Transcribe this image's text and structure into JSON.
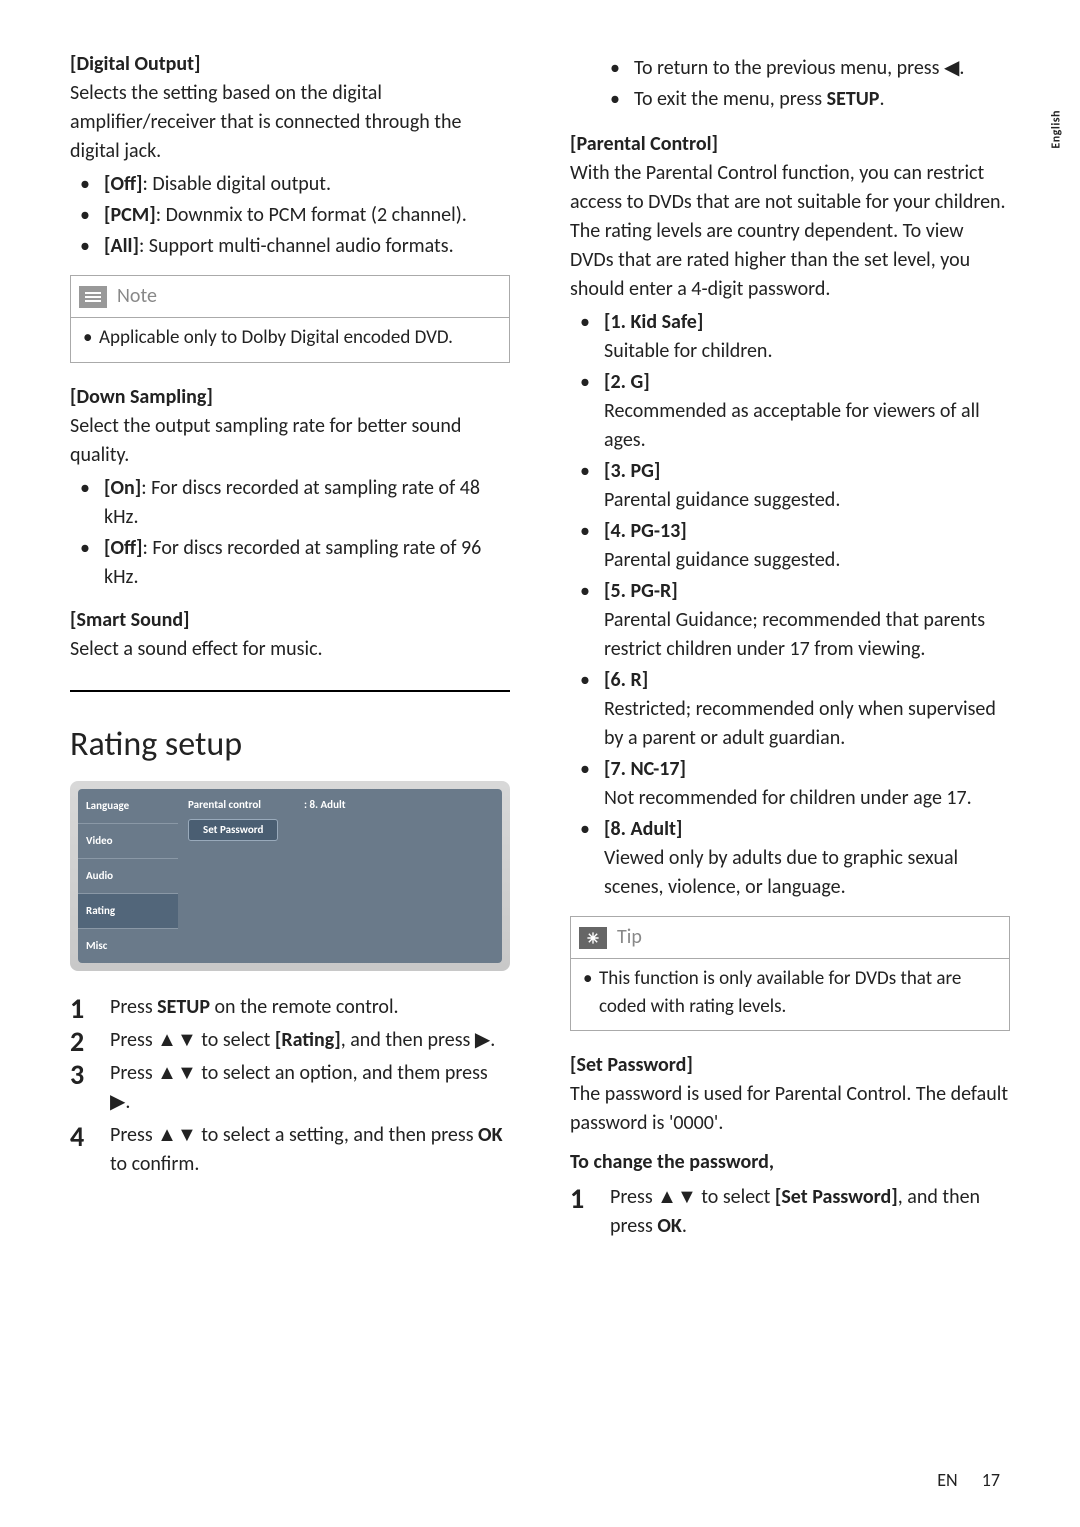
{
  "side_lang": "English",
  "left": {
    "digital_output": {
      "title": "[Digital Output]",
      "intro": "Selects the setting based on the digital amplifier/receiver that is connected through the digital jack.",
      "items": [
        {
          "label": "[Off]",
          "desc": ": Disable digital output."
        },
        {
          "label": "[PCM]",
          "desc": ": Downmix to PCM format (2 channel)."
        },
        {
          "label": "[All]",
          "desc": ": Support multi-channel audio formats."
        }
      ]
    },
    "note": {
      "heading": "Note",
      "text": "Applicable only to Dolby Digital encoded DVD."
    },
    "down_sampling": {
      "title": "[Down Sampling]",
      "intro": "Select the output sampling rate for better sound quality.",
      "items": [
        {
          "label": "[On]",
          "desc": ": For discs recorded at sampling rate of 48 kHz."
        },
        {
          "label": "[Off]",
          "desc": ": For discs recorded at sampling rate of 96 kHz."
        }
      ]
    },
    "smart_sound": {
      "title": "[Smart Sound]",
      "intro": "Select a sound effect for music."
    },
    "rating_heading": "Rating setup",
    "menu": {
      "tabs": [
        "Language",
        "Video",
        "Audio",
        "Rating",
        "Misc"
      ],
      "selected_index": 3,
      "row_label": "Parental control",
      "row_value": ":   8. Adult",
      "button": "Set Password"
    },
    "steps": [
      {
        "pre": "Press ",
        "b1": "SETUP",
        "post": " on the remote control."
      },
      {
        "pre": "Press ",
        "icons": "▲▼",
        "mid": " to select ",
        "b1": "[Rating]",
        "post": ", and then press ",
        "tail_icon": "▶",
        "tail": "."
      },
      {
        "pre": "Press ",
        "icons": "▲▼",
        "mid": " to select an option, and them press ",
        "tail_icon": "▶",
        "tail": "."
      },
      {
        "pre": "Press ",
        "icons": "▲▼",
        "mid": " to select a setting, and then press ",
        "b1": "OK",
        "post": " to confirm."
      }
    ]
  },
  "right": {
    "top_bullets": [
      {
        "text_pre": "To return to the previous menu, press ",
        "icon": "◀",
        "text_post": "."
      },
      {
        "text_pre": "To exit the menu, press ",
        "bold": "SETUP",
        "text_post": "."
      }
    ],
    "parental": {
      "title": "[Parental Control]",
      "intro": "With the Parental Control function, you can restrict access to DVDs that are not suitable for your children. The rating levels are country dependent. To view DVDs that are rated higher than the set level, you should enter a 4-digit password.",
      "levels": [
        {
          "label": "[1. Kid Safe]",
          "desc": "Suitable for children."
        },
        {
          "label": "[2. G]",
          "desc": "Recommended as acceptable for viewers of all ages."
        },
        {
          "label": "[3. PG]",
          "desc": "Parental guidance suggested."
        },
        {
          "label": "[4. PG-13]",
          "desc": "Parental guidance suggested."
        },
        {
          "label": "[5. PG-R]",
          "desc": "Parental Guidance; recommended that parents restrict children under 17 from viewing."
        },
        {
          "label": "[6. R]",
          "desc": "Restricted; recommended only when supervised by a parent or adult guardian."
        },
        {
          "label": "[7. NC-17]",
          "desc": "Not recommended for children under age 17."
        },
        {
          "label": "[8. Adult]",
          "desc": "Viewed only by adults due to graphic sexual scenes, violence, or language."
        }
      ]
    },
    "tip": {
      "heading": "Tip",
      "text": "This function is only available for DVDs that are coded with rating levels."
    },
    "set_password": {
      "title": "[Set Password]",
      "intro": "The password is used for Parental Control. The default password is '0000'.",
      "change_heading": "To change the password,",
      "step_pre": "Press ",
      "step_icons": "▲▼",
      "step_mid": " to select ",
      "step_bold": "[Set Password]",
      "step_post": ", and then press ",
      "step_bold2": "OK",
      "step_tail": "."
    }
  },
  "footer": {
    "en": "EN",
    "page": "17"
  }
}
